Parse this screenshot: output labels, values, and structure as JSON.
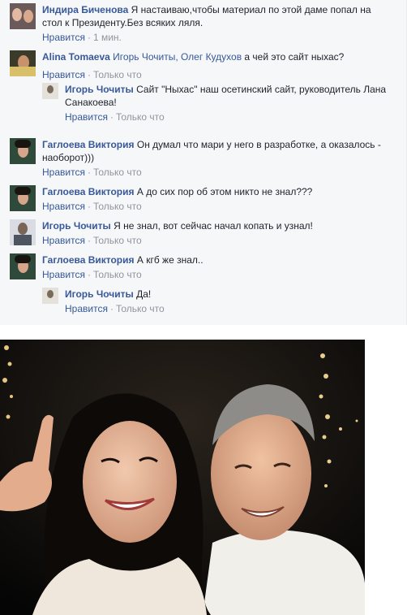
{
  "comments": [
    {
      "author": "Индира Биченова",
      "mentions": "",
      "text": "Я настаиваю,чтобы материал по этой даме попал на стол к Президенту.Без всяких ляля.",
      "like_label": "Нравится",
      "time": "1 мин."
    },
    {
      "author": "Alina Tomaeva",
      "mentions": "Игорь Чочиты, Олег Кудухов",
      "text": "а чей это сайт ныхас?",
      "like_label": "Нравится",
      "time": "Только что"
    },
    {
      "author": "Игорь Чочиты",
      "mentions": "",
      "text": "Сайт \"Ныхас\" наш осетинский сайт, руководитель Лана Санакоева!",
      "like_label": "Нравится",
      "time": "Только что"
    },
    {
      "author": "Гаглоева Виктория",
      "mentions": "",
      "text": "Он думал что мари у него в разработке, а оказалось - наоборот)))",
      "like_label": "Нравится",
      "time": "Только что"
    },
    {
      "author": "Гаглоева Виктория",
      "mentions": "",
      "text": "А до сих пор об этом никто не знал???",
      "like_label": "Нравится",
      "time": "Только что"
    },
    {
      "author": "Игорь Чочиты",
      "mentions": "",
      "text": "Я не знал, вот сейчас начал копать и узнал!",
      "like_label": "Нравится",
      "time": "Только что"
    },
    {
      "author": "Гаглоева Виктория",
      "mentions": "",
      "text": "А кгб же знал..",
      "like_label": "Нравится",
      "time": "Только что"
    },
    {
      "author": "Игорь Чочиты",
      "mentions": "",
      "text": "Да!",
      "like_label": "Нравится",
      "time": "Только что"
    }
  ],
  "colors": {
    "author": "#385898",
    "meta": "#90949c",
    "panel": "#f6f7f9"
  }
}
